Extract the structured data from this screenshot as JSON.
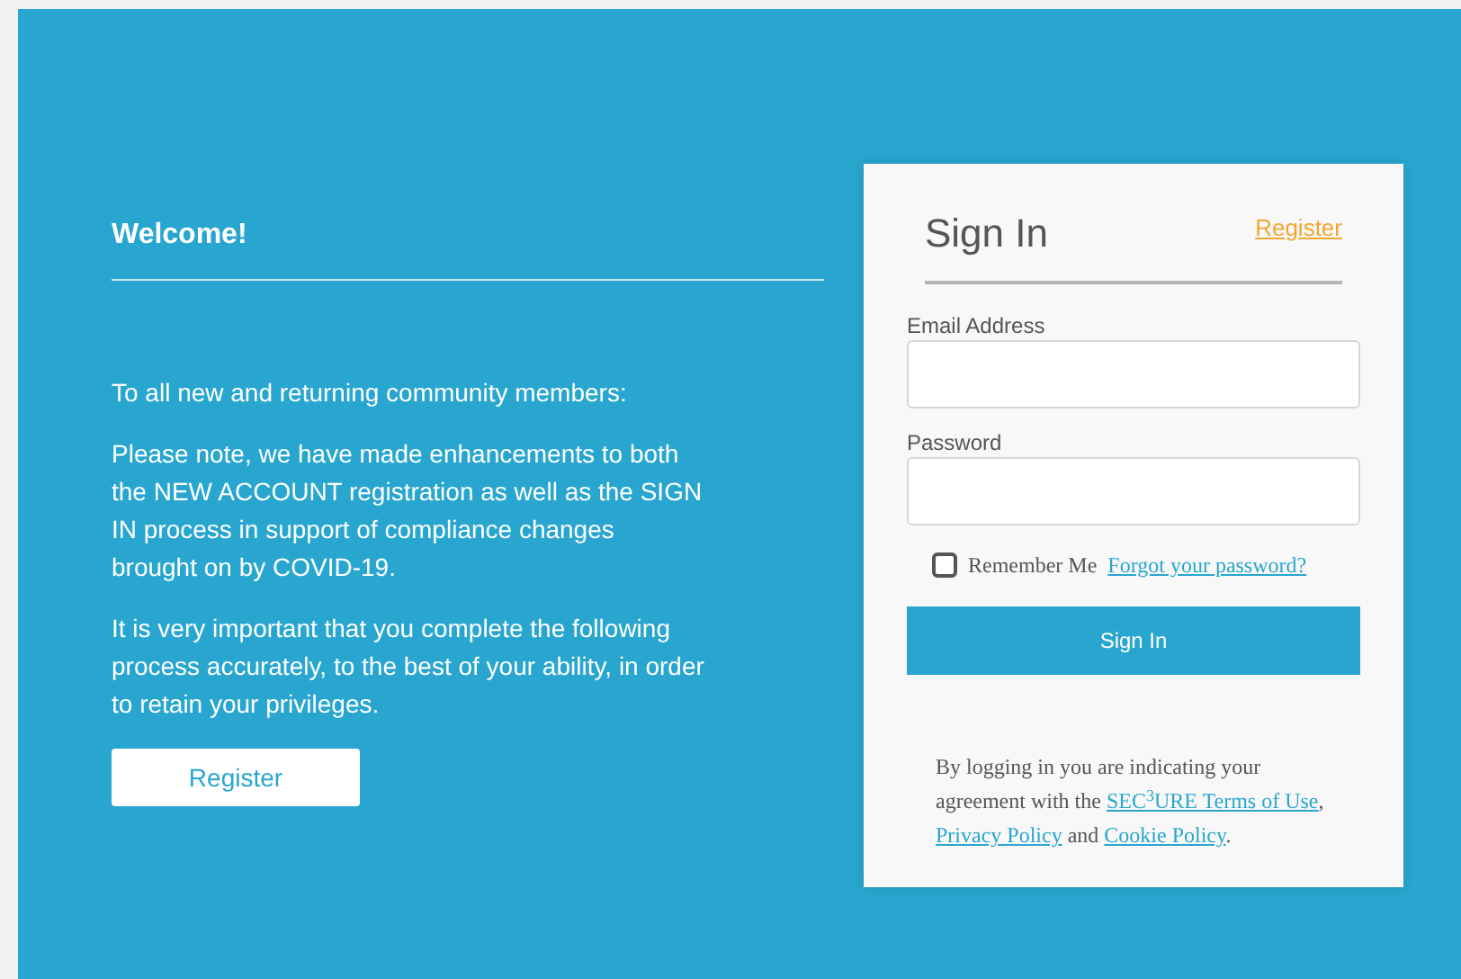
{
  "welcome": {
    "title": "Welcome!",
    "paragraphs": [
      "To all new and returning community members:",
      "Please note, we have made enhancements to both the NEW ACCOUNT registration as well as the SIGN IN process in support of compliance changes brought on by COVID-19.",
      "It is very important that you complete the following process accurately, to the best of your ability, in order to retain your privileges."
    ],
    "register_button": "Register"
  },
  "sign_in": {
    "title": "Sign In",
    "register_link": "Register",
    "fields": [
      {
        "label": "Email Address"
      },
      {
        "label": "Password"
      }
    ],
    "remember_me": {
      "label": "Remember Me",
      "checked": false
    },
    "forgot_link": "Forgot your password?",
    "submit_button": "Sign In",
    "agreement": [
      {
        "kind": "text",
        "text": "By logging in you are indicating your agreement with the "
      },
      {
        "kind": "link",
        "text": "SEC$^{3}$URE Terms of Use"
      },
      {
        "kind": "text",
        "text": ", "
      },
      {
        "kind": "link",
        "text": "Privacy Policy"
      },
      {
        "kind": "text",
        "text": " and "
      },
      {
        "kind": "link",
        "text": "Cookie Policy"
      },
      {
        "kind": "text",
        "text": "."
      }
    ]
  }
}
